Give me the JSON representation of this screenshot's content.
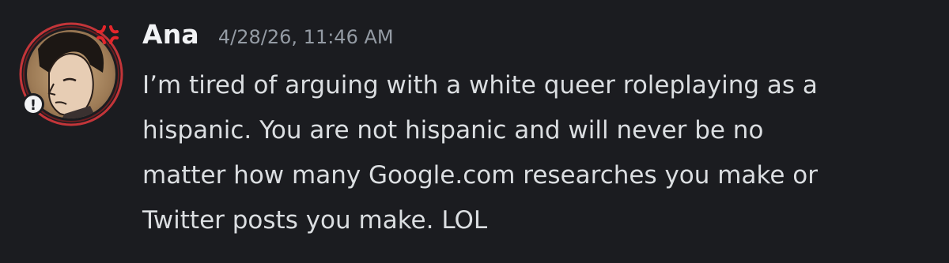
{
  "message": {
    "author": "Ana",
    "timestamp": "4/28/26, 11:46 AM",
    "lines": [
      "I’m tired of arguing with a white queer roleplaying as a",
      "hispanic. You are not hispanic and will never be no",
      "matter how many Google.com researches you make or",
      "Twitter posts you make. LOL"
    ],
    "avatar": {
      "ring_color": "#e03a3e",
      "badge_icon": "exclamation-icon",
      "badge_text": "!",
      "anger_icon": "anger-symbol-icon"
    }
  }
}
